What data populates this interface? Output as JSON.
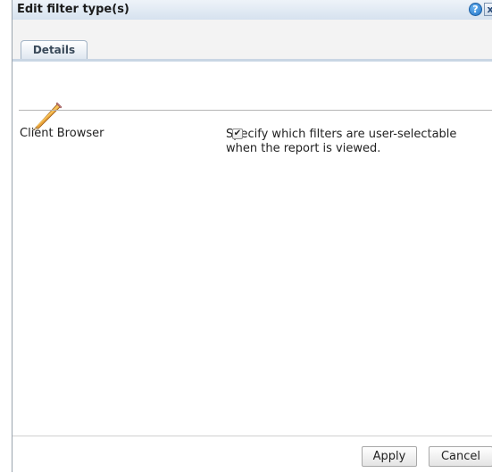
{
  "dialog": {
    "title": "Edit filter type(s)",
    "help_glyph": "?",
    "close_glyph": "x"
  },
  "tabs": [
    {
      "label": "Details",
      "selected": true
    }
  ],
  "header": {
    "icon": "pencil-icon",
    "instructions_line1": "Specify which filters are user-selectable",
    "instructions_line2": "when the report is viewed."
  },
  "filters": [
    {
      "label": "Client Browser",
      "checked": true,
      "check_glyph": "✔"
    }
  ],
  "footer": {
    "apply_label": "Apply",
    "cancel_label": "Cancel"
  }
}
